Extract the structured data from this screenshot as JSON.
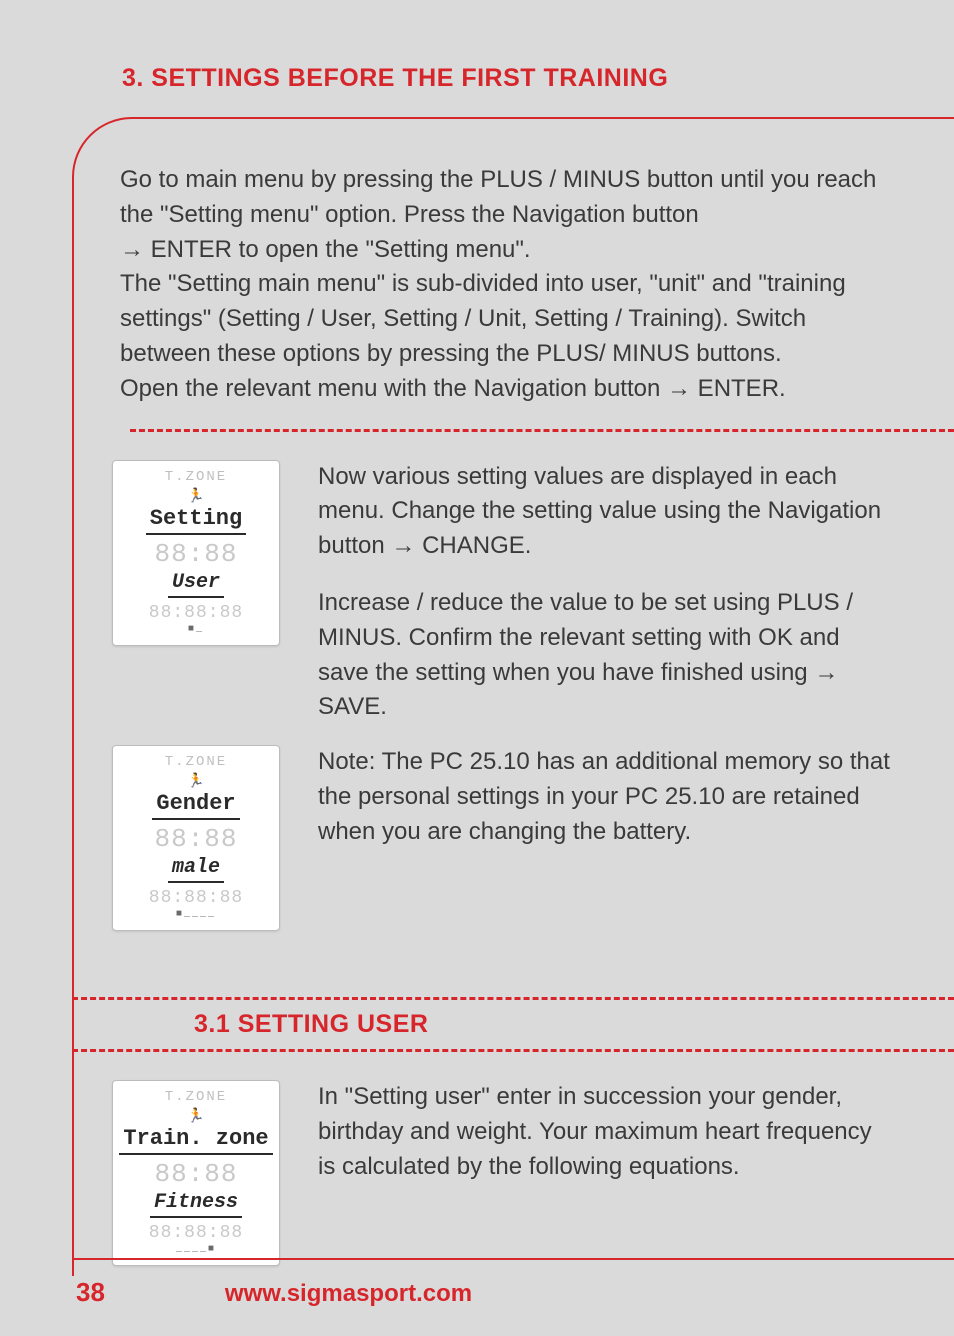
{
  "heading": "3. SETTINGS BEFORE THE FIRST TRAINING",
  "intro": {
    "line1": "Go to main menu by pressing the PLUS / MINUS button until you reach the \"Setting menu\" option. Press the Navigation button",
    "line2_prefix": "→",
    "line2": " ENTER to open the \"Setting menu\".",
    "line3": "The \"Setting main menu\" is sub-divided into user, \"unit\" and \"training settings\" (Setting / User, Setting / Unit, Setting / Training). Switch between these options by pressing the PLUS/ MINUS buttons.",
    "line4_pre": "Open the relevant menu with the Navigation button ",
    "line4_arrow": "→",
    "line4_post": " ENTER."
  },
  "screens": {
    "s1": {
      "tzone": "T.ZONE",
      "main": "Setting",
      "digits_big": "88:88",
      "sub": "User",
      "digits_small": "88:88:88",
      "marks": "■_"
    },
    "s2": {
      "tzone": "T.ZONE",
      "main": "Gender",
      "digits_big": "88:88",
      "sub": "male",
      "digits_small": "88:88:88",
      "marks": "■____"
    },
    "s3": {
      "tzone": "T.ZONE",
      "main": "Train. zone",
      "digits_big": "88:88",
      "sub": "Fitness",
      "digits_small": "88:88:88",
      "marks": "____■"
    }
  },
  "body": {
    "p1_pre": "Now various setting values are displayed in each menu. Change the setting value using the Navigation button ",
    "p1_arrow": "→",
    "p1_post": " CHANGE.",
    "p2_pre": "Increase / reduce the value to be set using PLUS / MINUS. Confirm the relevant setting with OK and save the setting when you have finished using ",
    "p2_arrow": "→",
    "p2_post": " SAVE.",
    "p3": "Note: The PC 25.10 has an additional memory so that the personal settings in your PC 25.10 are retained when you are changing the battery."
  },
  "subheading": "3.1 SETTING USER",
  "user_section": {
    "p1": "In \"Setting user\" enter in succession your gender, birthday and weight. Your maximum heart frequency is calculated by the following equations."
  },
  "footer": {
    "page": "38",
    "url": "www.sigmasport.com"
  }
}
